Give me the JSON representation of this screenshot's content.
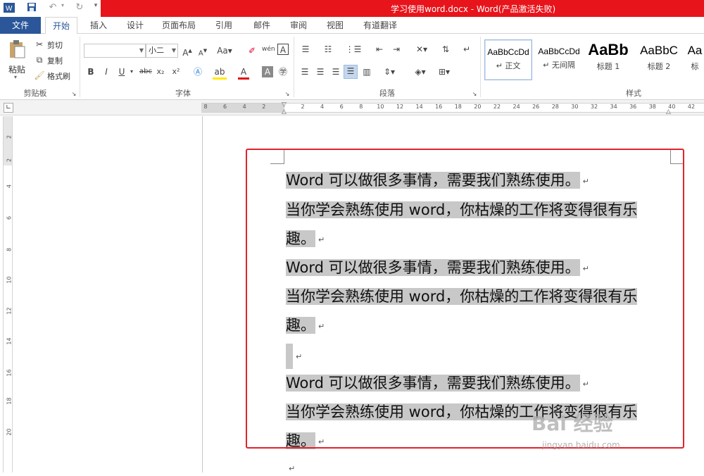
{
  "title_bar": {
    "title": "学习使用word.docx - Word(产品激活失败)"
  },
  "tabs": [
    "文件",
    "开始",
    "插入",
    "设计",
    "页面布局",
    "引用",
    "邮件",
    "审阅",
    "视图",
    "有道翻译"
  ],
  "ribbon": {
    "clipboard": {
      "paste": "粘贴",
      "cut": "剪切",
      "copy": "复制",
      "format_painter": "格式刷",
      "label": "剪贴板"
    },
    "font": {
      "font_name": "",
      "font_size": "小二",
      "label": "字体"
    },
    "paragraph": {
      "label": "段落"
    },
    "styles": {
      "label": "样式",
      "items": [
        {
          "sample": "AaBbCcDd",
          "name": "↵ 正文"
        },
        {
          "sample": "AaBbCcDd",
          "name": "↵ 无间隔"
        },
        {
          "sample": "AaBb",
          "name": "标题 1"
        },
        {
          "sample": "AaBbC",
          "name": "标题 2"
        },
        {
          "sample": "Aa",
          "name": "标"
        }
      ]
    }
  },
  "ruler": {
    "numbers": [
      "8",
      "6",
      "4",
      "2",
      "",
      "2",
      "4",
      "6",
      "8",
      "10",
      "12",
      "14",
      "16",
      "18",
      "20",
      "22",
      "24",
      "26",
      "28",
      "30",
      "32",
      "34",
      "36",
      "38",
      "40",
      "42"
    ]
  },
  "vruler": {
    "numbers": [
      "2",
      "2",
      "4",
      "6",
      "8",
      "10",
      "12",
      "14",
      "16",
      "18",
      "20"
    ]
  },
  "document": {
    "lines": [
      {
        "text": "Word 可以做很多事情，需要我们熟练使用。",
        "mark": "↵"
      },
      {
        "text": "当你学会熟练使用 word，你枯燥的工作将变得很有乐",
        "mark": ""
      },
      {
        "text": "趣。",
        "mark": "↵"
      },
      {
        "text": "Word 可以做很多事情，需要我们熟练使用。",
        "mark": "↵"
      },
      {
        "text": "当你学会熟练使用 word，你枯燥的工作将变得很有乐",
        "mark": ""
      },
      {
        "text": "趣。",
        "mark": "↵"
      },
      {
        "text": "",
        "mark": "↵"
      },
      {
        "text": "Word 可以做很多事情，需要我们熟练使用。",
        "mark": "↵"
      },
      {
        "text": "当你学会熟练使用 word，你枯燥的工作将变得很有乐",
        "mark": ""
      },
      {
        "text": "趣。",
        "mark": "↵"
      },
      {
        "text": "",
        "mark": "↵"
      }
    ]
  },
  "watermark": {
    "main": "Bai 经验",
    "sub": "jingyan.baidu.com"
  },
  "colors": {
    "title_red": "#e8141b",
    "file_blue": "#2b579a",
    "highlight": "#c8c8c8",
    "annotation_red": "#e0232c"
  }
}
